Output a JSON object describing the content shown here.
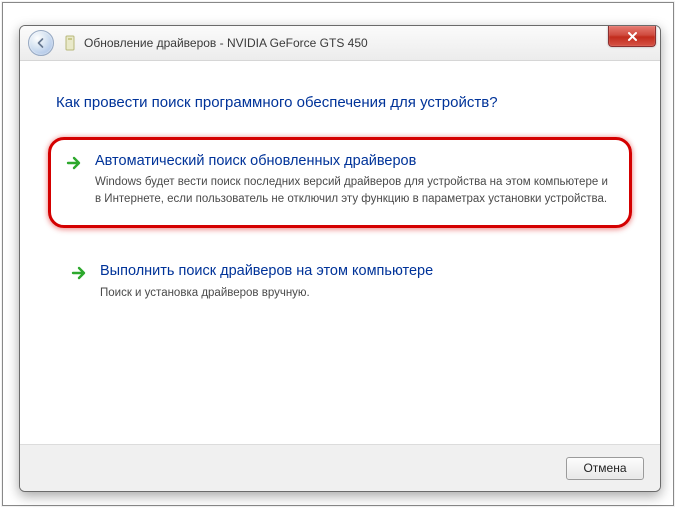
{
  "window": {
    "title": "Обновление драйверов - NVIDIA GeForce GTS 450"
  },
  "heading": "Как провести поиск программного обеспечения для устройств?",
  "options": [
    {
      "title": "Автоматический поиск обновленных драйверов",
      "desc": "Windows будет вести поиск последних версий драйверов для устройства на этом компьютере и в Интернете, если пользователь не отключил эту функцию в параметрах установки устройства."
    },
    {
      "title": "Выполнить поиск драйверов на этом компьютере",
      "desc": "Поиск и установка драйверов вручную."
    }
  ],
  "buttons": {
    "cancel": "Отмена"
  }
}
